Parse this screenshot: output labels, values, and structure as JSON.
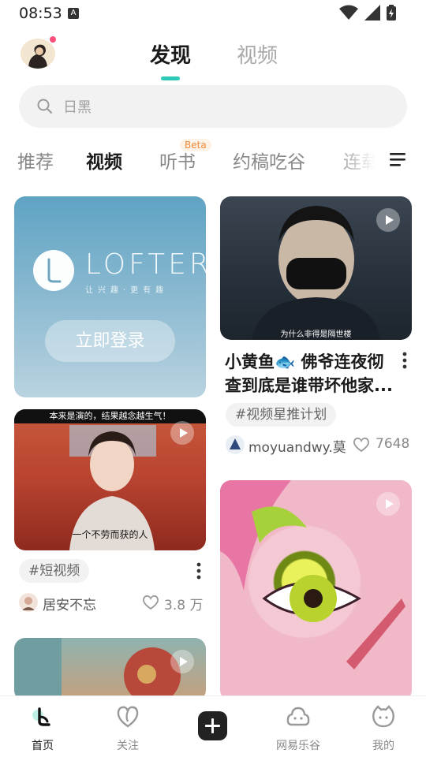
{
  "status_bar": {
    "time": "08:53",
    "notification_glyph": "A"
  },
  "header": {
    "tabs": [
      {
        "label": "发现",
        "active": true
      },
      {
        "label": "视频",
        "active": false
      }
    ],
    "accent_color": "#2cc9b6",
    "avatar_badge_color": "#ff4f7b"
  },
  "search": {
    "placeholder": "日黑"
  },
  "categories": {
    "items": [
      {
        "label": "推荐",
        "active": false
      },
      {
        "label": "视频",
        "active": true
      },
      {
        "label": "听书",
        "active": false,
        "badge": "Beta"
      },
      {
        "label": "约稿吃谷",
        "active": false
      },
      {
        "label": "连载",
        "active": false
      }
    ],
    "menu_icon": "hamburger-menu-icon"
  },
  "feed": {
    "login_card": {
      "logo_text": "LOFTER",
      "slogan": "让兴趣·更有趣",
      "button_label": "立即登录"
    },
    "video_1": {
      "caption": "为什么非得是隔世楼",
      "title": "小黄鱼🐟 佛爷连夜彻查到底是谁带坏他家...",
      "tag": "#视频星推计划",
      "author": "moyuandwy.莫",
      "likes": "7648"
    },
    "video_2": {
      "banner": "本来是演的，结果越念越生气！",
      "subtitle": "一个不劳而获的人",
      "tag": "#短视频",
      "author": "居安不忘",
      "likes": "3.8 万"
    }
  },
  "bottom_nav": {
    "items": [
      {
        "label": "首页",
        "icon": "lofter-home-icon",
        "active": true
      },
      {
        "label": "关注",
        "icon": "heart-follow-icon",
        "active": false
      },
      {
        "label": "网易乐谷",
        "icon": "cloud-face-icon",
        "active": false
      },
      {
        "label": "我的",
        "icon": "cat-face-icon",
        "active": false
      }
    ],
    "post_icon": "plus-icon"
  }
}
